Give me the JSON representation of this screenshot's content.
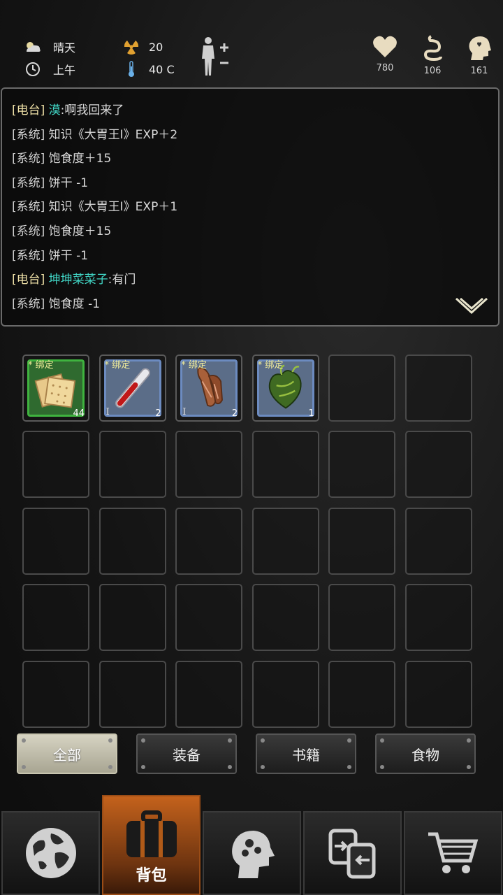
{
  "status": {
    "weather": "晴天",
    "time": "上午",
    "radiation": "20",
    "temperature": "40 C",
    "health": "780",
    "hunger": "106",
    "mental": "161"
  },
  "log": [
    {
      "tag": "[电台]",
      "speaker": "漠",
      "text": ":啊我回来了",
      "radio": true
    },
    {
      "tag": "[系统]",
      "speaker": "",
      "text": "知识《大胃王Ⅰ》EXP＋2",
      "radio": false
    },
    {
      "tag": "[系统]",
      "speaker": "",
      "text": "饱食度＋15",
      "radio": false
    },
    {
      "tag": "[系统]",
      "speaker": "",
      "text": "饼干 -1",
      "radio": false
    },
    {
      "tag": "[系统]",
      "speaker": "",
      "text": "知识《大胃王Ⅰ》EXP＋1",
      "radio": false
    },
    {
      "tag": "[系统]",
      "speaker": "",
      "text": "饱食度＋15",
      "radio": false
    },
    {
      "tag": "[系统]",
      "speaker": "",
      "text": "饼干 -1",
      "radio": false
    },
    {
      "tag": "[电台]",
      "speaker": "坤坤菜菜子",
      "text": ":有门",
      "radio": true
    },
    {
      "tag": "[系统]",
      "speaker": "",
      "text": "饱食度 -1",
      "radio": false
    }
  ],
  "inventory": {
    "items": [
      {
        "name": "biscuit",
        "bind": "* 绑定",
        "count": "44",
        "level": "",
        "rarity": "green"
      },
      {
        "name": "blood-tube",
        "bind": "* 绑定",
        "count": "2",
        "level": "I",
        "rarity": "blue"
      },
      {
        "name": "meat-strips",
        "bind": "* 绑定",
        "count": "2",
        "level": "I",
        "rarity": "blue"
      },
      {
        "name": "green-heart",
        "bind": "* 绑定",
        "count": "1",
        "level": "",
        "rarity": "blue"
      }
    ],
    "total_slots": 30
  },
  "filters": {
    "all": "全部",
    "equipment": "装备",
    "books": "书籍",
    "food": "食物",
    "active": "all"
  },
  "nav": {
    "backpack": "背包",
    "active": "backpack"
  },
  "colors": {
    "radio_tag": "#f0e2a8",
    "speaker": "#41d6c6",
    "active_tab": "#c4621c"
  }
}
